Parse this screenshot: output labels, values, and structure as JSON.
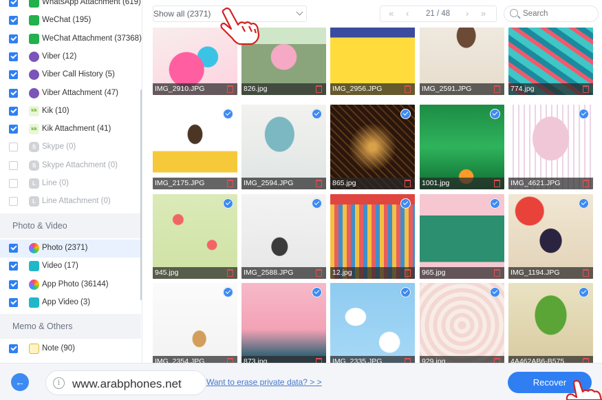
{
  "sidebar": {
    "items": [
      {
        "label": "WhatsApp Attachment (619)",
        "checked": true,
        "icon": "whatsapp-icon",
        "state": "normal"
      },
      {
        "label": "WeChat (195)",
        "checked": true,
        "icon": "wechat-icon",
        "state": "normal"
      },
      {
        "label": "WeChat Attachment (37368)",
        "checked": true,
        "icon": "wechat-icon",
        "state": "normal"
      },
      {
        "label": "Viber (12)",
        "checked": true,
        "icon": "viber-icon",
        "state": "normal"
      },
      {
        "label": "Viber Call History (5)",
        "checked": true,
        "icon": "viber-icon",
        "state": "normal"
      },
      {
        "label": "Viber Attachment (47)",
        "checked": true,
        "icon": "viber-icon",
        "state": "normal"
      },
      {
        "label": "Kik (10)",
        "checked": true,
        "icon": "kik-icon",
        "state": "normal"
      },
      {
        "label": "Kik Attachment (41)",
        "checked": true,
        "icon": "kik-icon",
        "state": "normal"
      },
      {
        "label": "Skype (0)",
        "checked": false,
        "icon": "skype-icon",
        "state": "disabled"
      },
      {
        "label": "Skype Attachment (0)",
        "checked": false,
        "icon": "skype-icon",
        "state": "disabled"
      },
      {
        "label": "Line (0)",
        "checked": false,
        "icon": "line-icon",
        "state": "disabled"
      },
      {
        "label": "Line Attachment (0)",
        "checked": false,
        "icon": "line-icon",
        "state": "disabled"
      }
    ],
    "section_photo_video": "Photo & Video",
    "media_items": [
      {
        "label": "Photo (2371)",
        "checked": true,
        "icon": "photos-icon",
        "active": true
      },
      {
        "label": "Video (17)",
        "checked": true,
        "icon": "video-icon",
        "active": false
      },
      {
        "label": "App Photo (36144)",
        "checked": true,
        "icon": "photos-icon",
        "active": false
      },
      {
        "label": "App Video (3)",
        "checked": true,
        "icon": "video-icon",
        "active": false
      }
    ],
    "section_memo": "Memo & Others",
    "memo_items": [
      {
        "label": "Note (90)",
        "checked": true,
        "icon": "note-icon"
      }
    ]
  },
  "toolbar": {
    "filter_label": "Show all (2371)",
    "page_label": "21 / 48",
    "search_placeholder": "Search"
  },
  "grid": {
    "photos": [
      {
        "name": "IMG_2910.JPG",
        "checked": true
      },
      {
        "name": "826.jpg",
        "checked": true
      },
      {
        "name": "IMG_2956.JPG",
        "checked": true
      },
      {
        "name": "IMG_2591.JPG",
        "checked": true
      },
      {
        "name": "774.jpg",
        "checked": true
      },
      {
        "name": "IMG_2175.JPG",
        "checked": true
      },
      {
        "name": "IMG_2594.JPG",
        "checked": true
      },
      {
        "name": "865.jpg",
        "checked": true
      },
      {
        "name": "1001.jpg",
        "checked": true
      },
      {
        "name": "IMG_4621.JPG",
        "checked": true
      },
      {
        "name": "945.jpg",
        "checked": true
      },
      {
        "name": "IMG_2588.JPG",
        "checked": true
      },
      {
        "name": "12.jpg",
        "checked": true
      },
      {
        "name": "965.jpg",
        "checked": true
      },
      {
        "name": "IMG_1194.JPG",
        "checked": true
      },
      {
        "name": "IMG_2354.JPG",
        "checked": true
      },
      {
        "name": "873.jpg",
        "checked": true
      },
      {
        "name": "IMG_2335.JPG",
        "checked": true
      },
      {
        "name": "929.jpg",
        "checked": true
      },
      {
        "name": "4A462AB6-B575",
        "checked": true
      }
    ]
  },
  "footer": {
    "watermark_url": "www.arabphones.net",
    "erase_link": "Want to erase private data? > >",
    "recover_label": "Recover"
  },
  "colors": {
    "accent": "#2f7ff3",
    "active_row": "#e8f1fd",
    "delete_red": "#e25050"
  }
}
